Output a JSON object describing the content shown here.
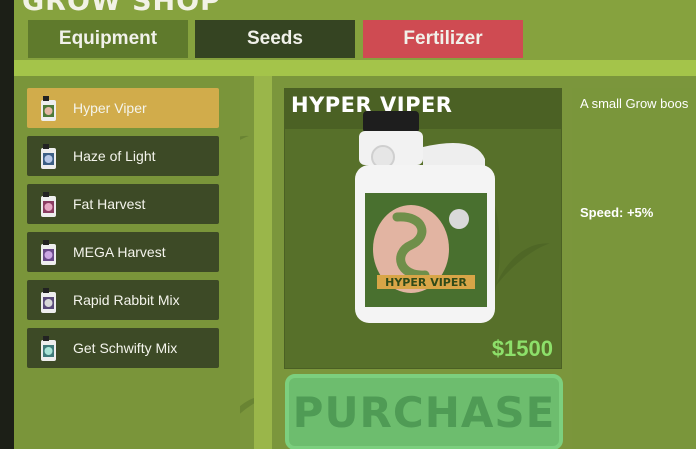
{
  "shop": {
    "title": "GROW SHOP"
  },
  "tabs": [
    {
      "label": "Equipment",
      "active": false
    },
    {
      "label": "Seeds",
      "active": false
    },
    {
      "label": "Fertilizer",
      "active": true
    }
  ],
  "items": [
    {
      "label": "Hyper Viper",
      "selected": true
    },
    {
      "label": "Haze of Light",
      "selected": false
    },
    {
      "label": "Fat Harvest",
      "selected": false
    },
    {
      "label": "MEGA Harvest",
      "selected": false
    },
    {
      "label": "Rapid Rabbit Mix",
      "selected": false
    },
    {
      "label": "Get Schwifty Mix",
      "selected": false
    }
  ],
  "product": {
    "name": "HYPER VIPER",
    "bottle_label": "HYPER VIPER",
    "price": "$1500",
    "purchase_label": "PURCHASE",
    "description": "A small Grow boos",
    "speed": "Speed: +5%"
  },
  "colors": {
    "selected_item": "#d1ac4b",
    "fertilizer_tab": "#cf4b52",
    "price": "#8de06a",
    "purchase_button": "#6dbd6e"
  },
  "icons": {
    "item_thumb": "fertilizer-bottle-icon",
    "background": "cannabis-leaf-icon"
  }
}
